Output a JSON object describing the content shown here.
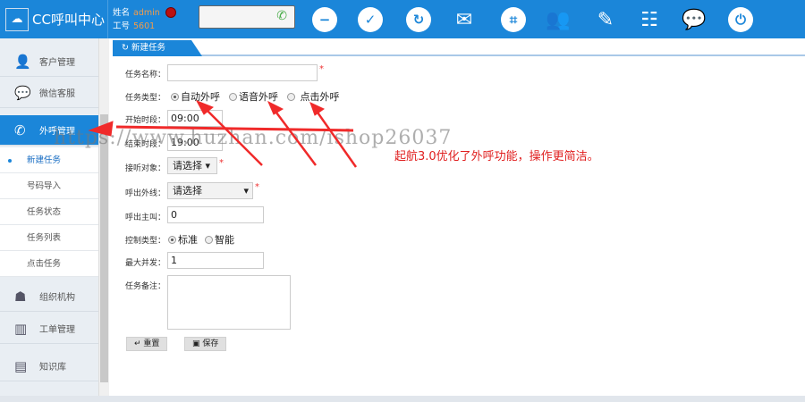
{
  "header": {
    "app_title": "CC呼叫中心",
    "name_label": "姓名",
    "name_value": "admin",
    "id_label": "工号",
    "id_value": "5601",
    "icons": [
      "minus-circle-icon",
      "check-circle-icon",
      "refresh-icon",
      "mail-icon",
      "keypad-icon",
      "users-icon",
      "edit-icon",
      "meeting-icon",
      "wechat-icon",
      "power-icon"
    ]
  },
  "sidebar": {
    "items": [
      {
        "label": "客户管理",
        "icon": "user-icon"
      },
      {
        "label": "微信客服",
        "icon": "wechat-icon"
      },
      {
        "label": "外呼管理",
        "icon": "phone-icon"
      },
      {
        "label": "组织机构",
        "icon": "org-icon"
      },
      {
        "label": "工单管理",
        "icon": "chart-icon"
      },
      {
        "label": "知识库",
        "icon": "book-icon"
      }
    ],
    "sub_items": [
      "新建任务",
      "号码导入",
      "任务状态",
      "任务列表",
      "点击任务"
    ]
  },
  "tab": {
    "label": "新建任务"
  },
  "form": {
    "task_name_label": "任务名称：",
    "task_name_value": "",
    "task_type_label": "任务类型：",
    "task_types": [
      "自动外呼",
      "语音外呼",
      "点击外呼"
    ],
    "start_label": "开始时段：",
    "start_value": "09:00",
    "end_label": "结束时段：",
    "end_value": "19:00",
    "target_label": "接听对象：",
    "target_value": "请选择",
    "line_label": "呼出外线：",
    "line_value": "请选择",
    "caller_label": "呼出主叫：",
    "caller_value": "0",
    "control_label": "控制类型：",
    "control_types": [
      "标准",
      "智能"
    ],
    "max_label": "最大并发：",
    "max_value": "1",
    "remark_label": "任务备注：",
    "remark_value": "",
    "reset_label": "重置",
    "save_label": "保存",
    "required": "*"
  },
  "annotation": {
    "note": "起航3.0优化了外呼功能，操作更简洁。",
    "watermark": "https://www.huzhan.com/ishop26037"
  },
  "colors": {
    "primary": "#1b86d9",
    "annotation": "#e02020"
  }
}
